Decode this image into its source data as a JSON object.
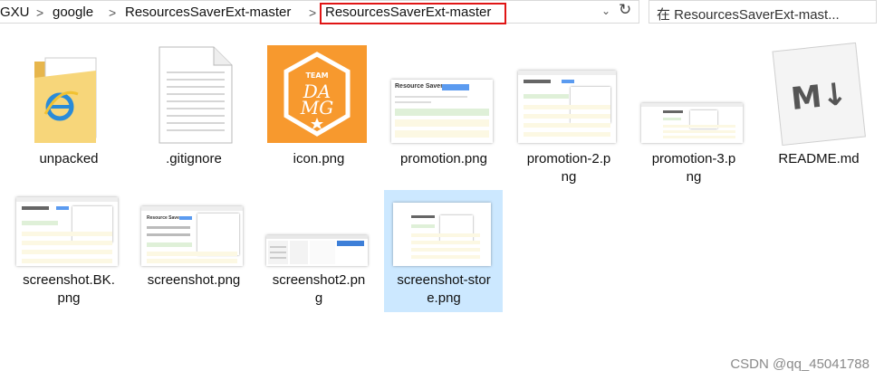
{
  "breadcrumb": {
    "items": [
      "GXU",
      "google",
      "ResourcesSaverExt-master",
      "ResourcesSaverExt-master"
    ],
    "separator": ">"
  },
  "search": {
    "placeholder": "在 ResourcesSaverExt-mast..."
  },
  "files": [
    {
      "name_line1": "unpacked",
      "name_line2": ""
    },
    {
      "name_line1": ".gitignore",
      "name_line2": ""
    },
    {
      "name_line1": "icon.png",
      "name_line2": ""
    },
    {
      "name_line1": "promotion.png",
      "name_line2": ""
    },
    {
      "name_line1": "promotion-2.p",
      "name_line2": "ng"
    },
    {
      "name_line1": "promotion-3.p",
      "name_line2": "ng"
    },
    {
      "name_line1": "README.md",
      "name_line2": ""
    },
    {
      "name_line1": "screenshot.BK.",
      "name_line2": "png"
    },
    {
      "name_line1": "screenshot.png",
      "name_line2": ""
    },
    {
      "name_line1": "screenshot2.pn",
      "name_line2": "g"
    },
    {
      "name_line1": "screenshot-stor",
      "name_line2": "e.png"
    }
  ],
  "icon_text": {
    "team": "TEAM",
    "word1": "DA",
    "word2": "MG"
  },
  "thumb_text": {
    "resource_saver": "Resource Saver"
  },
  "markdown_icon": "M↓",
  "watermark": "CSDN @qq_45041788",
  "colors": {
    "selection": "#cce8ff",
    "highlight_box": "#e01515",
    "icon_orange": "#f7992e"
  }
}
